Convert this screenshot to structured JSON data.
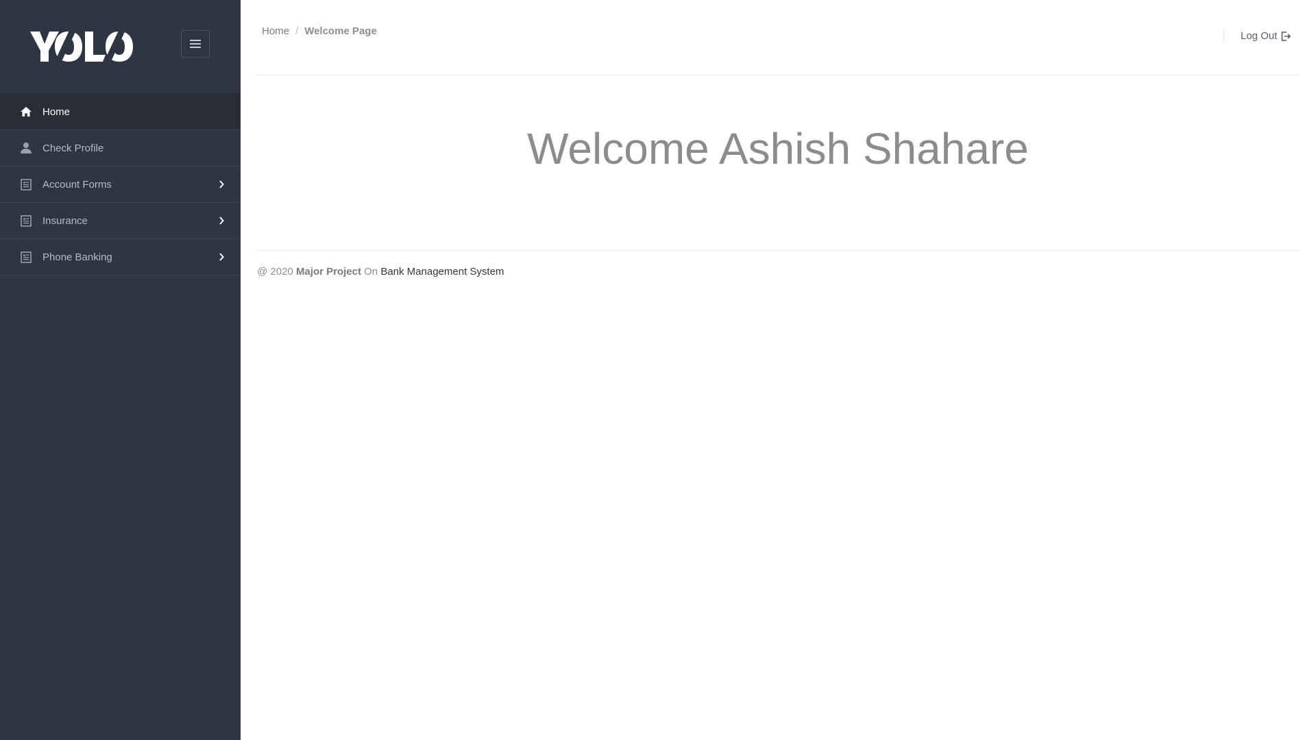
{
  "brand": {
    "logo_text": "YOLO"
  },
  "sidebar": {
    "items": [
      {
        "label": "Home",
        "icon": "home-icon",
        "active": true,
        "has_submenu": false
      },
      {
        "label": "Check Profile",
        "icon": "user-icon",
        "active": false,
        "has_submenu": false
      },
      {
        "label": "Account Forms",
        "icon": "form-icon",
        "active": false,
        "has_submenu": true
      },
      {
        "label": "Insurance",
        "icon": "form-icon",
        "active": false,
        "has_submenu": true
      },
      {
        "label": "Phone Banking",
        "icon": "form-icon",
        "active": false,
        "has_submenu": true
      }
    ]
  },
  "breadcrumb": {
    "home": "Home",
    "separator": "/",
    "current": "Welcome Page"
  },
  "header": {
    "logout_label": "Log Out"
  },
  "main": {
    "welcome": "Welcome Ashish Shahare"
  },
  "footer": {
    "prefix": "@ 2020",
    "project": "Major Project",
    "on": "On",
    "system": "Bank Management System"
  },
  "colors": {
    "sidebar_bg": "#2f3542",
    "sidebar_active_bg": "#282d38",
    "welcome_text": "#8c8c8c"
  }
}
